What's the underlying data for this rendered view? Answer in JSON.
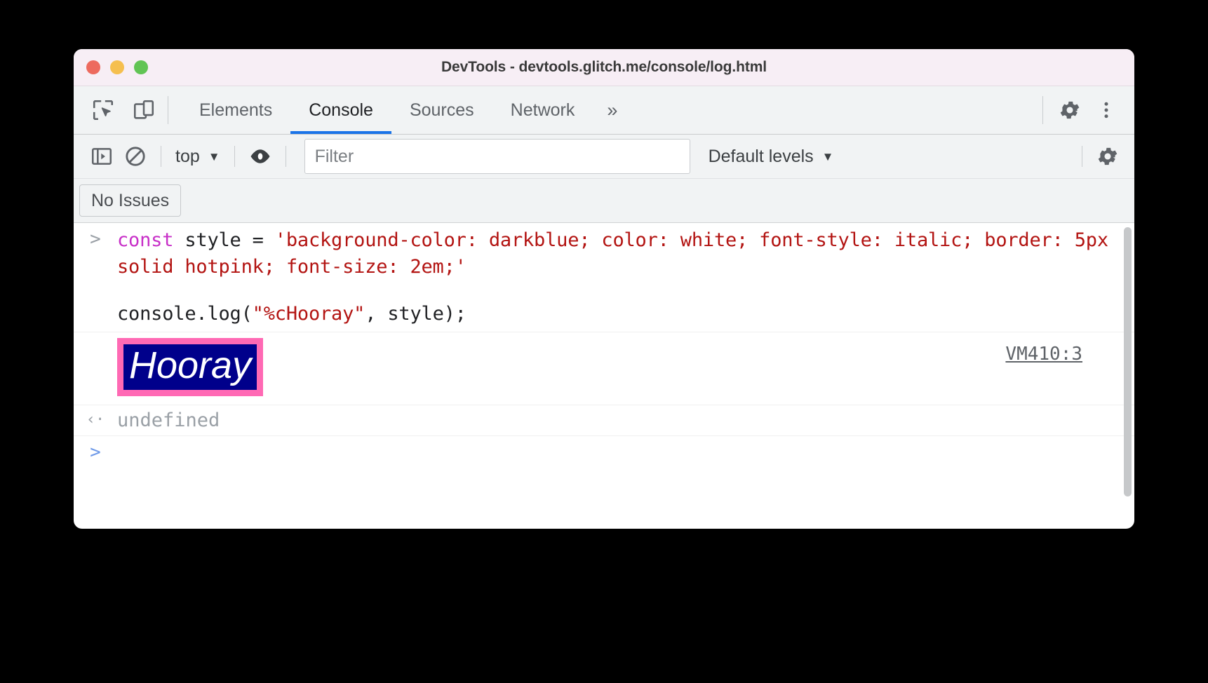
{
  "window": {
    "title": "DevTools - devtools.glitch.me/console/log.html",
    "traffic_lights": [
      {
        "name": "close",
        "color": "#ed6a5e"
      },
      {
        "name": "minimize",
        "color": "#f5bf4f"
      },
      {
        "name": "maximize",
        "color": "#61c454"
      }
    ]
  },
  "tabbar": {
    "icons": [
      {
        "name": "inspect-element-icon",
        "label": "Inspect element"
      },
      {
        "name": "device-toolbar-icon",
        "label": "Toggle device toolbar"
      }
    ],
    "tabs": [
      {
        "label": "Elements",
        "active": false
      },
      {
        "label": "Console",
        "active": true
      },
      {
        "label": "Sources",
        "active": false
      },
      {
        "label": "Network",
        "active": false
      }
    ],
    "more_label": "»",
    "settings_label": "Settings",
    "menu_label": "Customize and control DevTools"
  },
  "console_toolbar": {
    "sidebar_toggle": "Show console sidebar",
    "clear_label": "Clear console",
    "context": "top",
    "context_caret": "▼",
    "eye_label": "Create live expression",
    "filter": {
      "value": "",
      "placeholder": "Filter"
    },
    "levels": "Default levels",
    "levels_caret": "▼",
    "settings_label": "Console settings"
  },
  "issues_bar": {
    "button_label": "No Issues"
  },
  "console": {
    "entries": [
      {
        "type": "input",
        "prompt": ">",
        "tokens": [
          {
            "cls": "kw",
            "text": "const"
          },
          {
            "cls": "plain",
            "text": " style = "
          },
          {
            "cls": "str",
            "text": "'background-color: darkblue; color: white; font-style: italic; border: 5px solid hotpink; font-size: 2em;'"
          }
        ]
      },
      {
        "type": "input-continued",
        "tokens": [
          {
            "cls": "plain",
            "text": "console.log("
          },
          {
            "cls": "str",
            "text": "\"%cHooray\""
          },
          {
            "cls": "plain",
            "text": ", style);"
          }
        ]
      },
      {
        "type": "styled-output",
        "text": "Hooray",
        "source": "VM410:3",
        "style": {
          "background-color": "darkblue",
          "color": "white",
          "font-style": "italic",
          "border": "5px solid hotpink",
          "font-size": "2em"
        }
      },
      {
        "type": "return",
        "prompt": "‹·",
        "text": "undefined"
      },
      {
        "type": "prompt",
        "prompt": ">",
        "text": ""
      }
    ]
  },
  "colors": {
    "accent": "#1a73e8",
    "keyword": "#c830c8",
    "string": "#b31412",
    "hotpink": "#ff69b4",
    "darkblue": "#00008b",
    "muted": "#9aa0a6"
  }
}
